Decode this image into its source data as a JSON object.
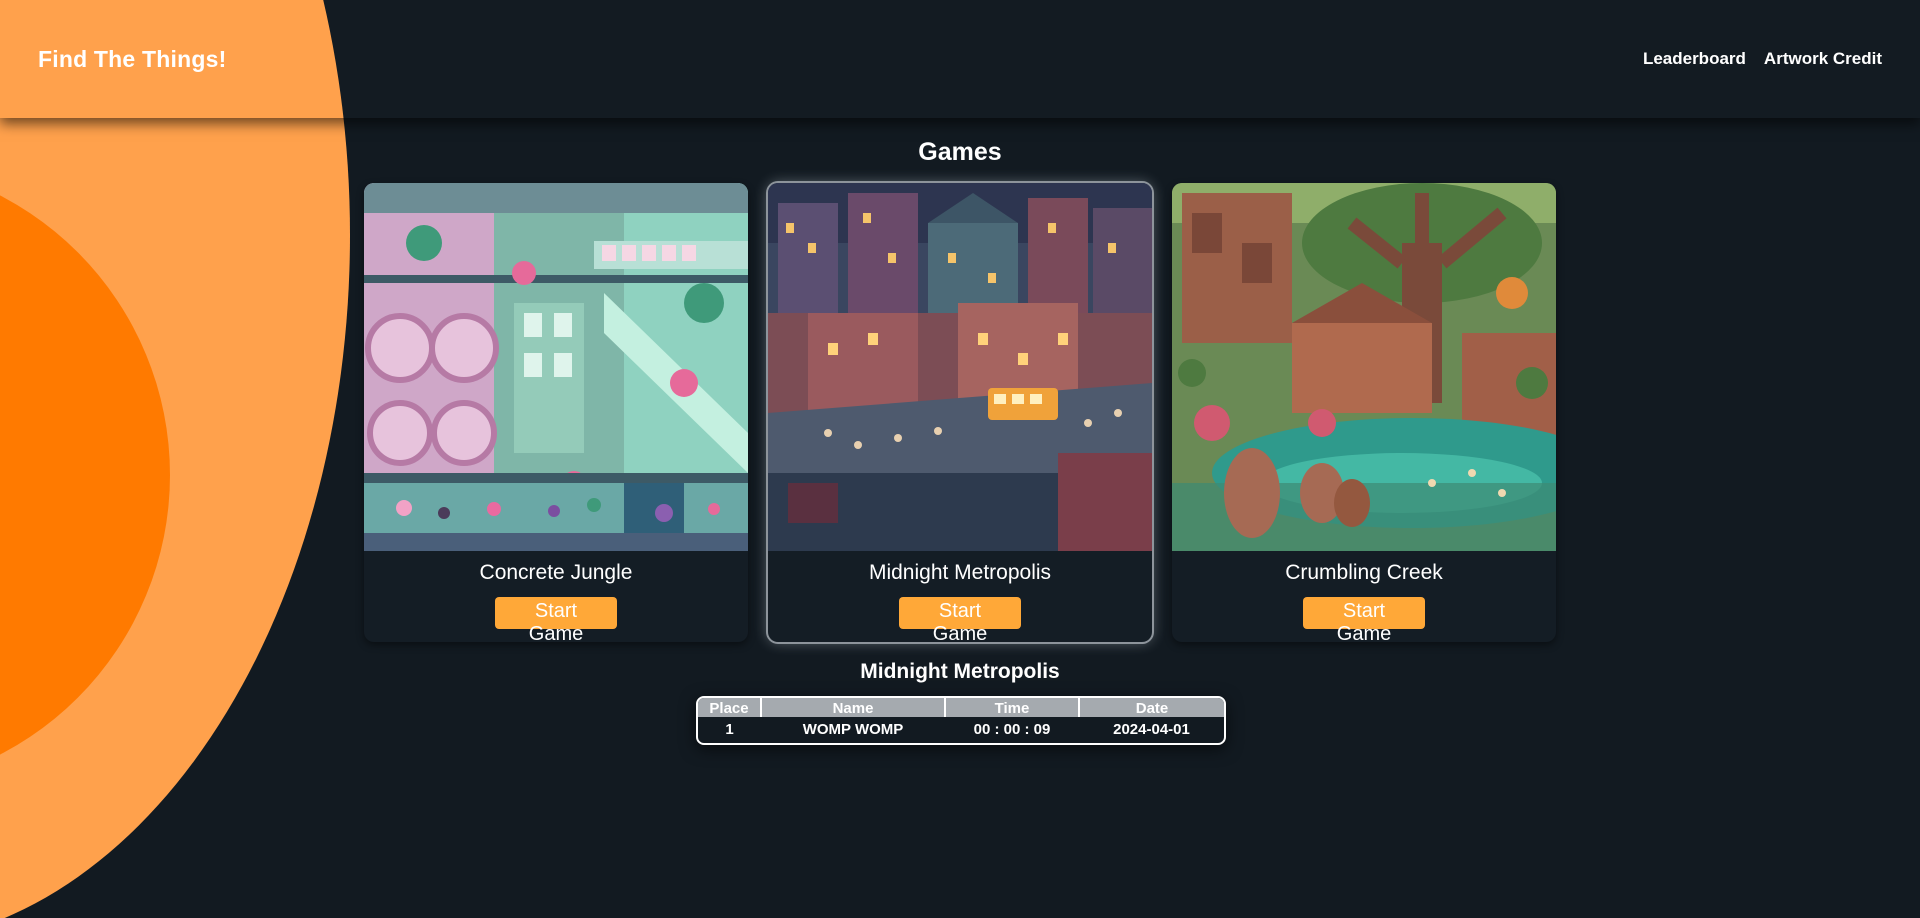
{
  "header": {
    "brand": "Find The Things!",
    "nav": [
      {
        "label": "Leaderboard"
      },
      {
        "label": "Artwork Credit"
      }
    ]
  },
  "main": {
    "title": "Games",
    "cards": [
      {
        "title": "Concrete Jungle",
        "button": "Start Game",
        "selected": false
      },
      {
        "title": "Midnight Metropolis",
        "button": "Start Game",
        "selected": true
      },
      {
        "title": "Crumbling Creek",
        "button": "Start Game",
        "selected": false
      }
    ]
  },
  "leaderboard": {
    "title": "Midnight Metropolis",
    "columns": [
      "Place",
      "Name",
      "Time",
      "Date"
    ],
    "rows": [
      {
        "place": "1",
        "name": "WOMP WOMP",
        "time": "00 : 00 : 09",
        "date": "2024-04-01"
      }
    ]
  },
  "colors": {
    "background": "#121a21",
    "accent_orange": "#ffa14c",
    "deep_orange": "#ff7a00",
    "button": "#ffa838"
  },
  "icons": {
    "card_art": [
      "concrete-jungle-artwork",
      "midnight-metropolis-artwork",
      "crumbling-creek-artwork"
    ]
  }
}
